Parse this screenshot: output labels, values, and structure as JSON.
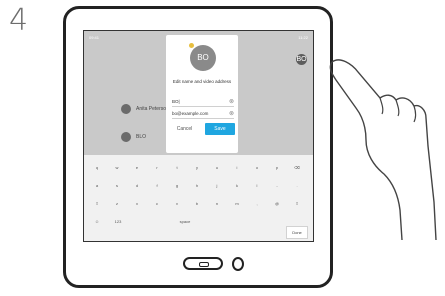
{
  "step": "4",
  "screen": {
    "status_left": "09:41",
    "status_right": "11:22",
    "bg_user_initials": "BO",
    "bg_contact_name": "Anita Peterson",
    "bg_contact_sub": "BLO",
    "bg_circle_initials": "BO"
  },
  "dialog": {
    "avatar_initials": "BO",
    "title": "Edit name and video address",
    "name_field": "BO|",
    "address_field": "bo@example.com",
    "cancel_label": "Cancel",
    "save_label": "Save"
  },
  "keyboard": {
    "done_label": "Done",
    "rows": [
      [
        "q",
        "w",
        "e",
        "r",
        "t",
        "y",
        "u",
        "i",
        "o",
        "p",
        "⌫"
      ],
      [
        "a",
        "s",
        "d",
        "f",
        "g",
        "h",
        "j",
        "k",
        "l",
        "-",
        "."
      ],
      [
        "⇧",
        "z",
        "x",
        "c",
        "v",
        "b",
        "n",
        "m",
        ",",
        "@",
        "⇧"
      ],
      [
        "☺",
        "123",
        "space"
      ]
    ]
  }
}
